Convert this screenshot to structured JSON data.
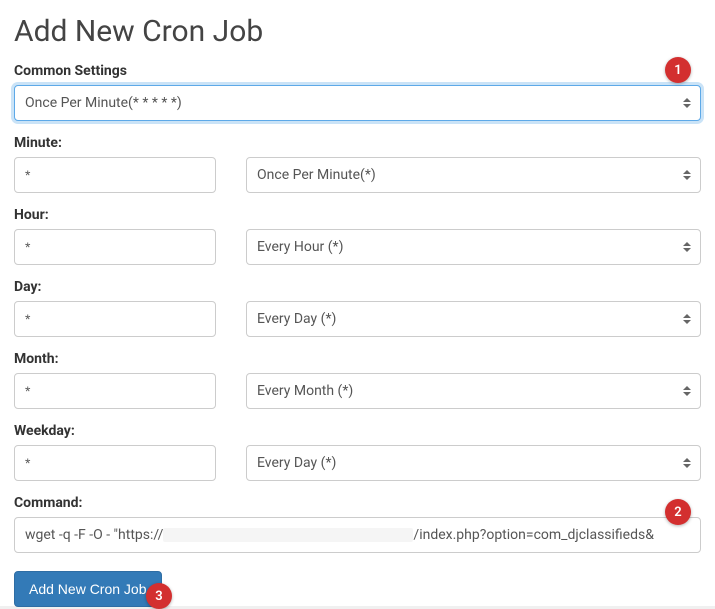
{
  "page": {
    "title": "Add New Cron Job"
  },
  "common_settings": {
    "label": "Common Settings",
    "value": "Once Per Minute(* * * * *)"
  },
  "fields": {
    "minute": {
      "label": "Minute:",
      "value": "*",
      "select": "Once Per Minute(*)"
    },
    "hour": {
      "label": "Hour:",
      "value": "*",
      "select": "Every Hour (*)"
    },
    "day": {
      "label": "Day:",
      "value": "*",
      "select": "Every Day (*)"
    },
    "month": {
      "label": "Month:",
      "value": "*",
      "select": "Every Month (*)"
    },
    "weekday": {
      "label": "Weekday:",
      "value": "*",
      "select": "Every Day (*)"
    }
  },
  "command": {
    "label": "Command:",
    "prefix": "wget -q -F -O - \"https://",
    "suffix": "/index.php?option=com_djclassifieds&"
  },
  "submit": {
    "label": "Add New Cron Job"
  },
  "annotations": {
    "a1": "1",
    "a2": "2",
    "a3": "3"
  }
}
